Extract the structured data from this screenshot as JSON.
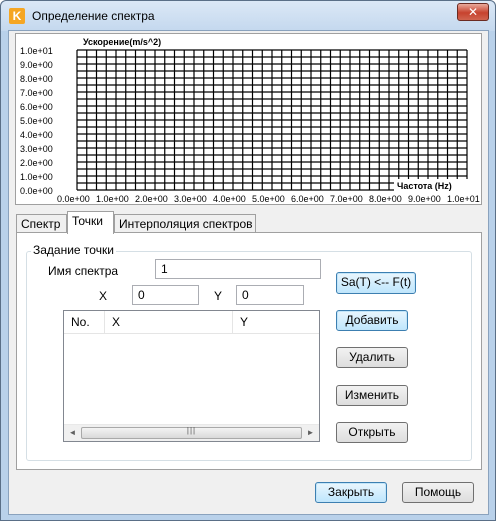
{
  "window": {
    "title": "Определение спектра",
    "close_glyph": "✕",
    "app_icon_glyph": "K"
  },
  "chart_data": {
    "type": "line",
    "title": "",
    "xlabel": "Частота (Hz)",
    "ylabel": "Ускорение(m/s^2)",
    "xlim": [
      0,
      10
    ],
    "ylim": [
      0,
      10
    ],
    "x_ticks": [
      0,
      1,
      2,
      3,
      4,
      5,
      6,
      7,
      8,
      9,
      10
    ],
    "x_tick_labels": [
      "0.0e+00",
      "1.0e+00",
      "2.0e+00",
      "3.0e+00",
      "4.0e+00",
      "5.0e+00",
      "6.0e+00",
      "7.0e+00",
      "8.0e+00",
      "9.0e+00",
      "1.0e+01"
    ],
    "y_ticks": [
      0,
      1,
      2,
      3,
      4,
      5,
      6,
      7,
      8,
      9,
      10
    ],
    "y_tick_labels": [
      "0.0e+00",
      "1.0e+00",
      "2.0e+00",
      "3.0e+00",
      "4.0e+00",
      "5.0e+00",
      "6.0e+00",
      "7.0e+00",
      "8.0e+00",
      "9.0e+00",
      "1.0e+01"
    ],
    "grid": true,
    "series": []
  },
  "tabs": [
    {
      "label": "Спектр",
      "active": false
    },
    {
      "label": "Точки",
      "active": true
    },
    {
      "label": "Интерполяция спектров",
      "active": false
    }
  ],
  "points": {
    "group_label": "Задание точки",
    "spectrum_name_label": "Имя спектра",
    "spectrum_name_value": "1",
    "x_label": "X",
    "x_value": "0",
    "y_label": "Y",
    "y_value": "0",
    "table": {
      "columns": [
        "No.",
        "X",
        "Y"
      ],
      "rows": []
    },
    "scroll_left": "◄",
    "scroll_right": "►",
    "scroll_grip": "|||"
  },
  "buttons": {
    "sa_from_f": "Sa(T) <-- F(t)",
    "add": "Добавить",
    "delete": "Удалить",
    "edit": "Изменить",
    "open": "Открыть",
    "close": "Закрыть",
    "help": "Помощь"
  },
  "colors": {
    "window_frame": "#b9d1ea",
    "focus_border": "#3c7fb1",
    "close_button": "#c7422e",
    "app_icon": "#f5a623"
  }
}
